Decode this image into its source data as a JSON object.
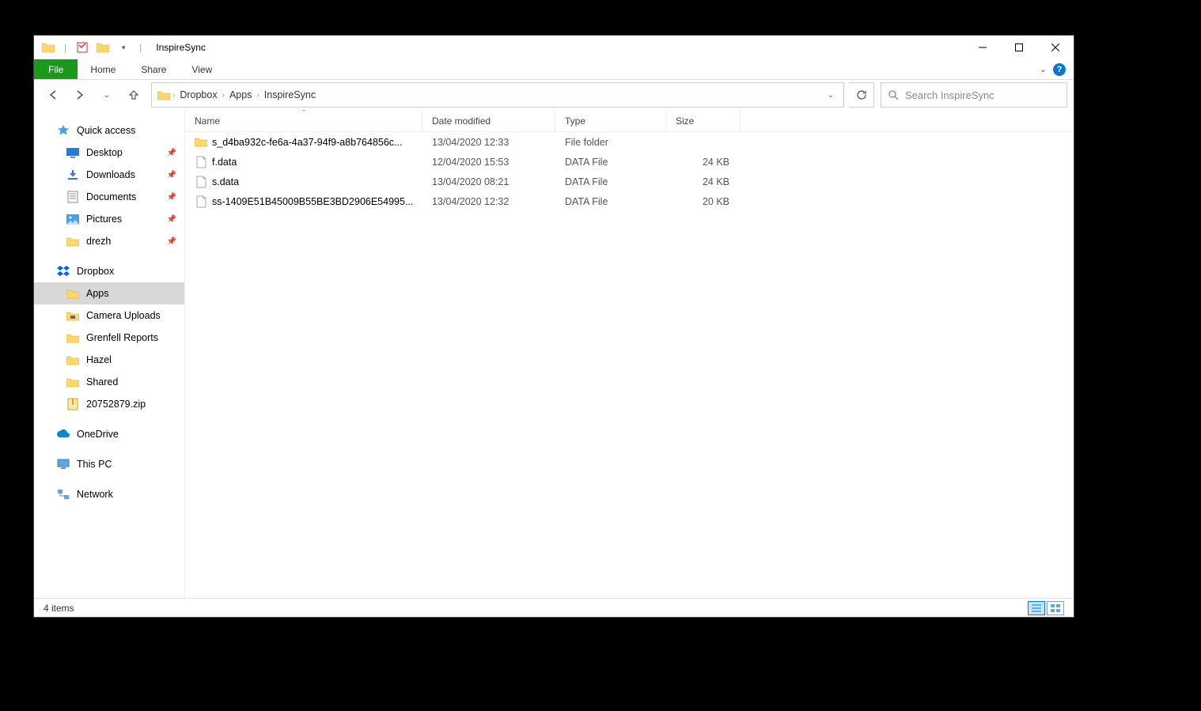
{
  "titlebar": {
    "title": "InspireSync"
  },
  "ribbon": {
    "file": "File",
    "tabs": [
      "Home",
      "Share",
      "View"
    ]
  },
  "breadcrumb": [
    "Dropbox",
    "Apps",
    "InspireSync"
  ],
  "search": {
    "placeholder": "Search InspireSync"
  },
  "sidebar": {
    "quick_access": "Quick access",
    "qa_items": [
      {
        "label": "Desktop",
        "pinned": true,
        "icon": "desktop"
      },
      {
        "label": "Downloads",
        "pinned": true,
        "icon": "downloads"
      },
      {
        "label": "Documents",
        "pinned": true,
        "icon": "documents"
      },
      {
        "label": "Pictures",
        "pinned": true,
        "icon": "pictures"
      },
      {
        "label": "drezh",
        "pinned": true,
        "icon": "folder"
      }
    ],
    "dropbox": "Dropbox",
    "db_items": [
      {
        "label": "Apps",
        "selected": true,
        "icon": "folder"
      },
      {
        "label": "Camera Uploads",
        "icon": "folder-cam"
      },
      {
        "label": "Grenfell Reports",
        "icon": "folder"
      },
      {
        "label": "Hazel",
        "icon": "folder"
      },
      {
        "label": "Shared",
        "icon": "folder"
      },
      {
        "label": "20752879.zip",
        "icon": "zip"
      }
    ],
    "onedrive": "OneDrive",
    "thispc": "This PC",
    "network": "Network"
  },
  "columns": {
    "name": "Name",
    "date": "Date modified",
    "type": "Type",
    "size": "Size"
  },
  "files": [
    {
      "name": "s_d4ba932c-fe6a-4a37-94f9-a8b764856c...",
      "date": "13/04/2020 12:33",
      "type": "File folder",
      "size": "",
      "icon": "folder"
    },
    {
      "name": "f.data",
      "date": "12/04/2020 15:53",
      "type": "DATA File",
      "size": "24 KB",
      "icon": "file"
    },
    {
      "name": "s.data",
      "date": "13/04/2020 08:21",
      "type": "DATA File",
      "size": "24 KB",
      "icon": "file"
    },
    {
      "name": "ss-1409E51B45009B55BE3BD2906E54995...",
      "date": "13/04/2020 12:32",
      "type": "DATA File",
      "size": "20 KB",
      "icon": "file"
    }
  ],
  "status": {
    "count": "4 items"
  }
}
